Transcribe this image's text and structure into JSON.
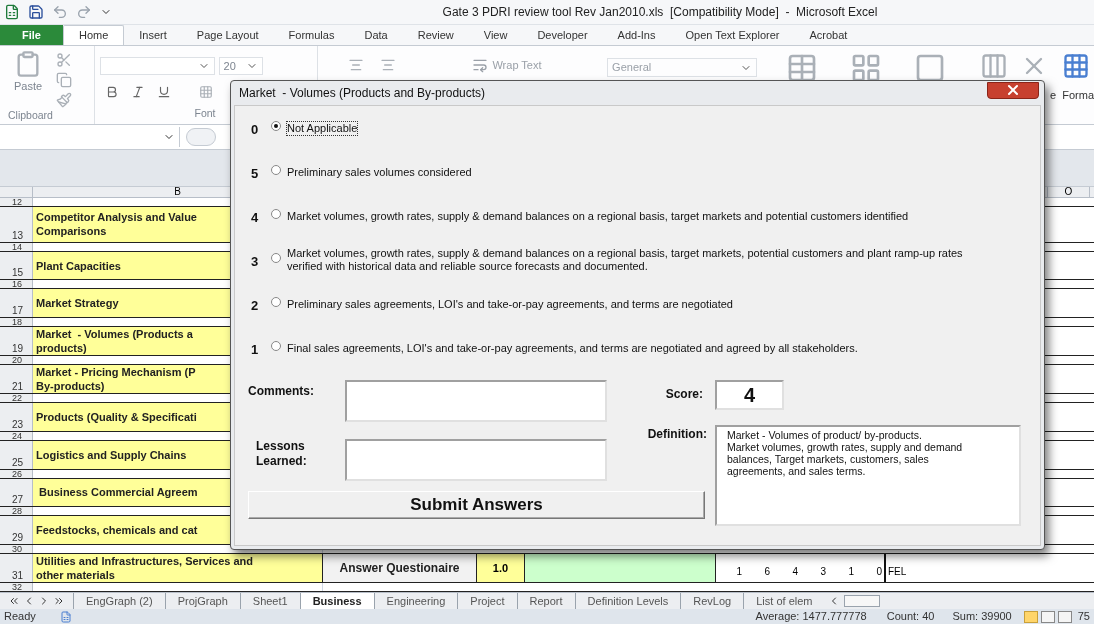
{
  "window": {
    "title": "Gate 3 PDRI review tool Rev Jan2010.xls  [Compatibility Mode]  -  Microsoft Excel"
  },
  "ribbon_tabs": [
    {
      "label": "File",
      "kind": "file",
      "selected": false
    },
    {
      "label": "Home",
      "kind": "tab",
      "selected": true
    },
    {
      "label": "Insert",
      "kind": "tab",
      "selected": false
    },
    {
      "label": "Page Layout",
      "kind": "tab",
      "selected": false
    },
    {
      "label": "Formulas",
      "kind": "tab",
      "selected": false
    },
    {
      "label": "Data",
      "kind": "tab",
      "selected": false
    },
    {
      "label": "Review",
      "kind": "tab",
      "selected": false
    },
    {
      "label": "View",
      "kind": "tab",
      "selected": false
    },
    {
      "label": "Developer",
      "kind": "tab",
      "selected": false
    },
    {
      "label": "Add-Ins",
      "kind": "tab",
      "selected": false
    },
    {
      "label": "Open Text Explorer",
      "kind": "tab",
      "selected": false
    },
    {
      "label": "Acrobat",
      "kind": "tab",
      "selected": false
    }
  ],
  "ribbon": {
    "paste": "Paste",
    "clipboard_group": "Clipboard",
    "font_group": "Font",
    "font_size": "20",
    "wrap_text": "Wrap Text",
    "number_format": "General",
    "delete_fragment": "e",
    "format": "Forma"
  },
  "sheet": {
    "columns": [
      "B",
      "O"
    ],
    "rows": [
      {
        "number": "12",
        "kind": "spacer"
      },
      {
        "number": "13",
        "kind": "item",
        "label": "Competitor Analysis and Value\nComparisons"
      },
      {
        "number": "14",
        "kind": "spacer"
      },
      {
        "number": "15",
        "kind": "item",
        "label": "Plant Capacities"
      },
      {
        "number": "16",
        "kind": "spacer"
      },
      {
        "number": "17",
        "kind": "item",
        "label": "Market Strategy"
      },
      {
        "number": "18",
        "kind": "spacer"
      },
      {
        "number": "19",
        "kind": "item",
        "label": "Market  - Volumes (Products a\nproducts)"
      },
      {
        "number": "20",
        "kind": "spacer"
      },
      {
        "number": "21",
        "kind": "item",
        "label": "Market - Pricing Mechanism (P\nBy-products)"
      },
      {
        "number": "22",
        "kind": "spacer"
      },
      {
        "number": "23",
        "kind": "item",
        "label": "Products (Quality & Specificati"
      },
      {
        "number": "24",
        "kind": "spacer"
      },
      {
        "number": "25",
        "kind": "item",
        "label": "Logistics and Supply Chains"
      },
      {
        "number": "26",
        "kind": "spacer"
      },
      {
        "number": "27",
        "kind": "item",
        "label": " Business Commercial Agreem"
      },
      {
        "number": "28",
        "kind": "spacer"
      },
      {
        "number": "29",
        "kind": "item",
        "label": "Feedstocks, chemicals and cat"
      },
      {
        "number": "30",
        "kind": "spacer"
      },
      {
        "number": "31",
        "kind": "full",
        "label": "Utilities and Infrastructures, Services and\nother materials",
        "action": "Answer Questionaire",
        "score": "1.0",
        "figures": [
          "1",
          "6",
          "4",
          "3",
          "1",
          "0"
        ],
        "tag": "FEL"
      },
      {
        "number": "32",
        "kind": "spacer"
      }
    ]
  },
  "sheet_tabs": [
    {
      "label": "EngGraph (2)",
      "selected": false
    },
    {
      "label": "ProjGraph",
      "selected": false
    },
    {
      "label": "Sheet1",
      "selected": false
    },
    {
      "label": "Business",
      "selected": true
    },
    {
      "label": "Engineering",
      "selected": false
    },
    {
      "label": "Project",
      "selected": false
    },
    {
      "label": "Report",
      "selected": false
    },
    {
      "label": "Definition Levels",
      "selected": false
    },
    {
      "label": "RevLog",
      "selected": false
    },
    {
      "label": "List of elem",
      "selected": false
    }
  ],
  "status_bar": {
    "mode": "Ready",
    "average": "Average: 1477.777778",
    "count": "Count: 40",
    "sum": "Sum: 39900",
    "zoom": "75",
    "views": [
      {
        "selected": true
      },
      {
        "selected": false
      },
      {
        "selected": false
      }
    ]
  },
  "dialog": {
    "title": "Market  - Volumes (Products and By-products)",
    "options": [
      {
        "score": "0",
        "label": "Not Applicable",
        "selected": true
      },
      {
        "score": "5",
        "label": "Preliminary sales volumes considered",
        "selected": false
      },
      {
        "score": "4",
        "label": "Market volumes, growth rates, supply & demand balances on a regional basis, target markets and potential customers identified",
        "selected": false
      },
      {
        "score": "3",
        "label": "Market volumes, growth rates, supply & demand balances on a regional basis, target markets, potential customers and plant ramp-up rates\nverified with historical data and reliable source forecasts and documented.",
        "selected": false
      },
      {
        "score": "2",
        "label": "Preliminary sales agreements, LOI's and take-or-pay agreements, and terms are negotiated",
        "selected": false
      },
      {
        "score": "1",
        "label": "Final sales agreements, LOI's and take-or-pay agreements, and terms are negotiated and agreed by all stakeholders.",
        "selected": false
      }
    ],
    "comments_label": "Comments:",
    "lessons_label": "Lessons\nLearned:",
    "score_label": "Score:",
    "score": "4",
    "definition_label": "Definition:",
    "definition": "Market - Volumes of product/ by-products.\nMarket volumes, growth rates, supply and demand balances, Target markets, customers, sales agreements, and sales terms.",
    "submit": "Submit Answers"
  }
}
